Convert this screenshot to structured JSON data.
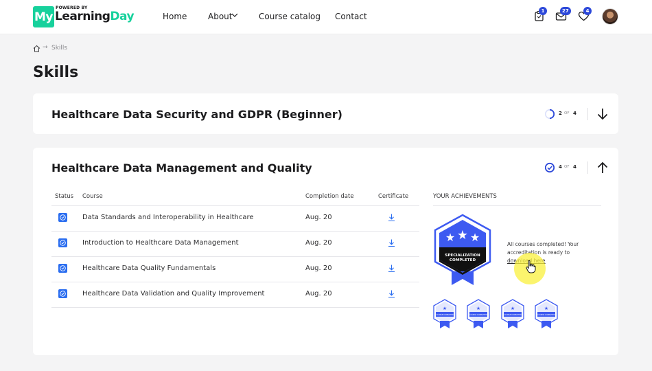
{
  "brand": {
    "powered_by": "POWERED BY",
    "my": "My",
    "learning": "Learning",
    "day": "Day"
  },
  "nav": {
    "home": "Home",
    "about": "About",
    "catalog": "Course catalog",
    "contact": "Contact"
  },
  "header_badges": {
    "cart": "1",
    "messages": "27",
    "favorites": "4"
  },
  "breadcrumb": {
    "arrow": "→",
    "current": "Skills"
  },
  "page_title": "Skills",
  "skills": [
    {
      "title": "Healthcare Data Security and GDPR (Beginner)",
      "done": "2",
      "of": "OF",
      "total": "4",
      "progress": 0.5
    },
    {
      "title": "Healthcare Data Management and Quality",
      "done": "4",
      "of": "OF",
      "total": "4",
      "progress": 1.0
    }
  ],
  "table": {
    "headers": {
      "status": "Status",
      "course": "Course",
      "completion": "Completion date",
      "certificate": "Certificate"
    },
    "rows": [
      {
        "course": "Data Standards and Interoperability in Healthcare",
        "date": "Aug. 20"
      },
      {
        "course": "Introduction to Healthcare Data Management",
        "date": "Aug. 20"
      },
      {
        "course": "Healthcare Data Quality Fundamentals",
        "date": "Aug. 20"
      },
      {
        "course": "Healthcare Data Validation and Quality Improvement",
        "date": "Aug. 20"
      }
    ]
  },
  "achievements": {
    "heading": "YOUR ACHIEVEMENTS",
    "badge_line1": "SPECIALIZATION",
    "badge_line2": "COMPLETED",
    "message_prefix": "All courses completed! Your accreditation is ready to",
    "download_link": "download here",
    "small_badge_label": "COURSE COMPLETED"
  },
  "colors": {
    "accent": "#2c48d9",
    "brand_green": "#17d19c",
    "status_blue": "#2b6ef0",
    "badge_blue": "#3d5af1"
  }
}
